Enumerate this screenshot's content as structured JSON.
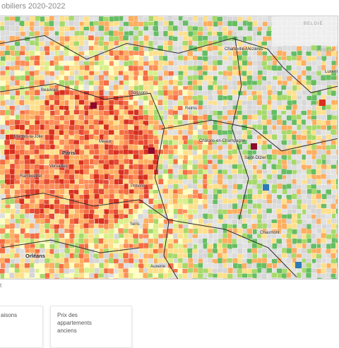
{
  "title": "obiliers 2020-2022",
  "places": [
    {
      "id": "paris",
      "label": "Paris",
      "big": true
    },
    {
      "id": "versailles",
      "label": "Versailles"
    },
    {
      "id": "mantes",
      "label": "Mantes-la-Jolie"
    },
    {
      "id": "rambouillet",
      "label": "Rambouillet"
    },
    {
      "id": "meaux",
      "label": "Meaux"
    },
    {
      "id": "beauvais",
      "label": "Beauvais"
    },
    {
      "id": "soissons",
      "label": "Soissons"
    },
    {
      "id": "reims",
      "label": "Reims"
    },
    {
      "id": "chalons",
      "label": "Châlons-en-Champagne"
    },
    {
      "id": "charleville",
      "label": "Charleville-Mézières"
    },
    {
      "id": "provins",
      "label": "Provins"
    },
    {
      "id": "sens",
      "label": "Sens"
    },
    {
      "id": "orleans",
      "label": "Orléans"
    },
    {
      "id": "auxerre",
      "label": "Auxerre"
    },
    {
      "id": "saintdizier",
      "label": "Saint-Dizier"
    },
    {
      "id": "chaumont",
      "label": "Chaumont"
    },
    {
      "id": "luxembourg",
      "label": "Luxem"
    },
    {
      "id": "belgium",
      "label": "BELGIË"
    },
    {
      "id": "luxcountry",
      "label": "LUXEM"
    }
  ],
  "below_text": "t",
  "cards": [
    {
      "id": "houses",
      "lines": [
        "aisons"
      ]
    },
    {
      "id": "apartments",
      "lines": [
        "Prix des",
        "appartements",
        "anciens"
      ]
    }
  ],
  "colors": {
    "map_bg": "#e9e9e9",
    "border": "#2b2b2b"
  }
}
